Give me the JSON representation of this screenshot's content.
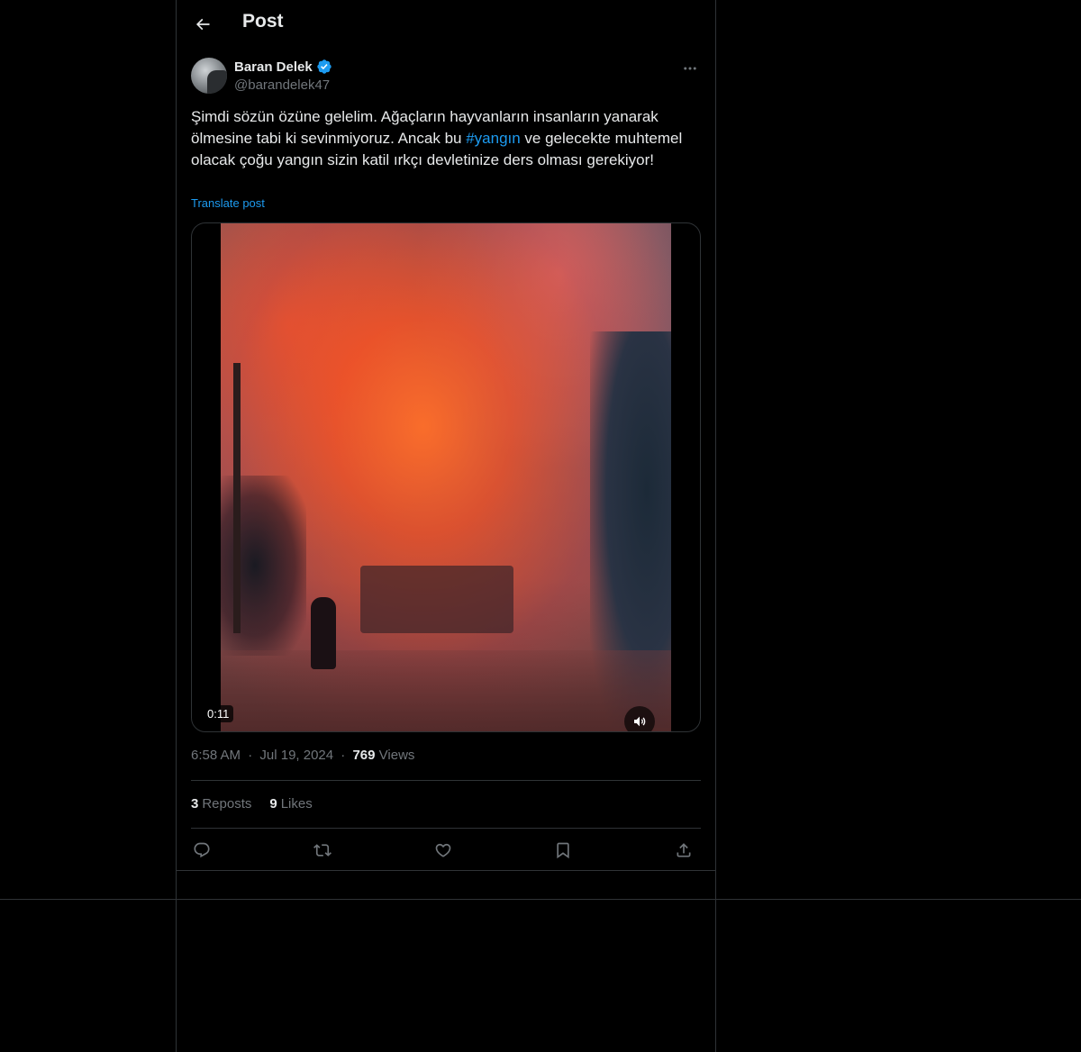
{
  "header": {
    "title": "Post"
  },
  "author": {
    "name": "Baran Delek",
    "handle": "@barandelek47",
    "verified": true
  },
  "post": {
    "text_before": "Şimdi sözün özüne gelelim. Ağaçların hayvanların insanların yanarak ölmesine tabi ki sevinmiyoruz. Ancak bu ",
    "hashtag": "#yangın",
    "text_after": " ve gelecekte muhtemel olacak çoğu yangın sizin katil ırkçı devletinize ders olması gerekiyor!",
    "translate_label": "Translate post"
  },
  "media": {
    "type": "video",
    "duration": "0:11"
  },
  "meta": {
    "time": "6:58 AM",
    "separator": "·",
    "date": "Jul 19, 2024",
    "views_count": "769",
    "views_label": "Views"
  },
  "stats": {
    "reposts_count": "3",
    "reposts_label": "Reposts",
    "likes_count": "9",
    "likes_label": "Likes"
  },
  "icons": {
    "back": "arrow-left-icon",
    "more": "more-horizontal-icon",
    "verified": "verified-badge-icon",
    "mute": "speaker-icon",
    "reply": "reply-icon",
    "repost": "repost-icon",
    "like": "heart-icon",
    "bookmark": "bookmark-icon",
    "share": "share-icon"
  },
  "colors": {
    "background": "#000000",
    "text": "#e7e9ea",
    "secondary": "#71767b",
    "accent": "#1d9bf0",
    "border": "#2f3336"
  }
}
